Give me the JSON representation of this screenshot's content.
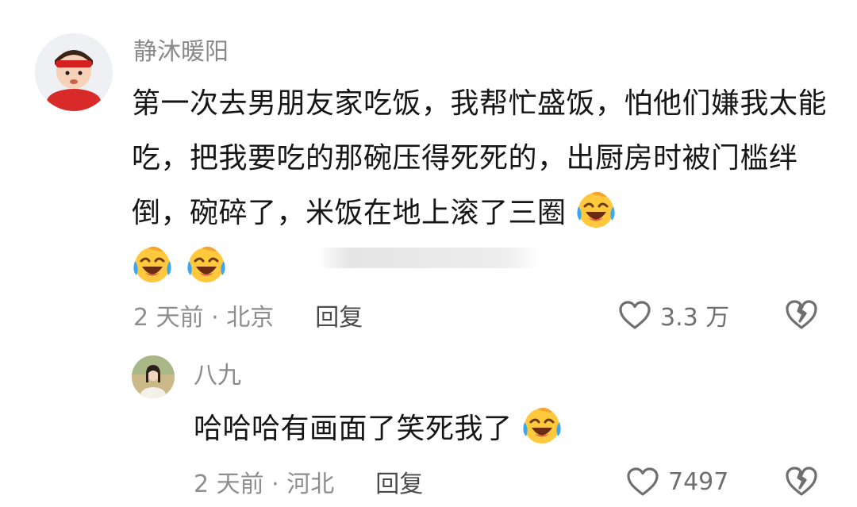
{
  "main_comment": {
    "author": "静沐暖阳",
    "text": "第一次去男朋友家吃饭，我帮忙盛饭，怕他们嫌我太能吃，把我要吃的那碗压得死死的，出厨房时被门槛绊倒，碗碎了，米饭在地上滚了三圈",
    "emojis": [
      "laugh-cry-emoji",
      "laugh-cry-emoji",
      "laugh-cry-emoji"
    ],
    "time_location": "2 天前 · 北京",
    "reply_label": "回复",
    "like_count": "3.3 万"
  },
  "reply_comment": {
    "author": "八九",
    "text": "哈哈哈有画面了笑死我了",
    "emojis": [
      "laugh-cry-emoji"
    ],
    "time_location": "2 天前 · 河北",
    "reply_label": "回复",
    "like_count": "7497"
  },
  "colors": {
    "text": "#161616",
    "meta": "#8e8e8e",
    "name": "#8a8a8a",
    "emoji_face": "#ffc83d",
    "tears": "#3aa7f0"
  },
  "icons": [
    "heart-icon",
    "broken-heart-icon"
  ]
}
